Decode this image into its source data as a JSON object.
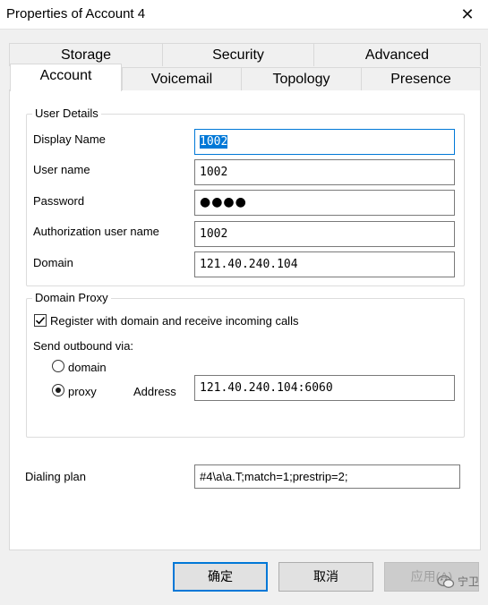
{
  "window": {
    "title": "Properties of Account 4",
    "close_glyph": "✕"
  },
  "tabs_back": [
    {
      "label": "Storage"
    },
    {
      "label": "Security"
    },
    {
      "label": "Advanced"
    }
  ],
  "tabs_front": [
    {
      "label": "Account",
      "active": true
    },
    {
      "label": "Voicemail",
      "active": false
    },
    {
      "label": "Topology",
      "active": false
    },
    {
      "label": "Presence",
      "active": false
    }
  ],
  "user_details": {
    "group_label": "User Details",
    "display_name": {
      "label": "Display Name",
      "value": "1002"
    },
    "user_name": {
      "label": "User name",
      "value": "1002"
    },
    "password": {
      "label": "Password",
      "value": "●●●●"
    },
    "auth_user_name": {
      "label": "Authorization user name",
      "value": "1002"
    },
    "domain": {
      "label": "Domain",
      "value": "121.40.240.104"
    }
  },
  "domain_proxy": {
    "group_label": "Domain Proxy",
    "register_checkbox": {
      "label": "Register with domain and receive incoming calls",
      "checked": true
    },
    "send_outbound_label": "Send outbound via:",
    "options": [
      {
        "label": "domain",
        "selected": false
      },
      {
        "label": "proxy",
        "selected": true
      }
    ],
    "address_label": "Address",
    "address_value": "121.40.240.104:6060"
  },
  "dialing_plan": {
    "label": "Dialing plan",
    "value": "#4\\a\\a.T;match=1;prestrip=2;"
  },
  "buttons": {
    "ok": "确定",
    "cancel": "取消",
    "apply": "应用(A)"
  },
  "watermark": {
    "text": "宁卫",
    "icon": "wechat-icon"
  },
  "colors": {
    "accent": "#0078d7",
    "panel": "#ffffff",
    "chrome": "#f0f0f0"
  }
}
